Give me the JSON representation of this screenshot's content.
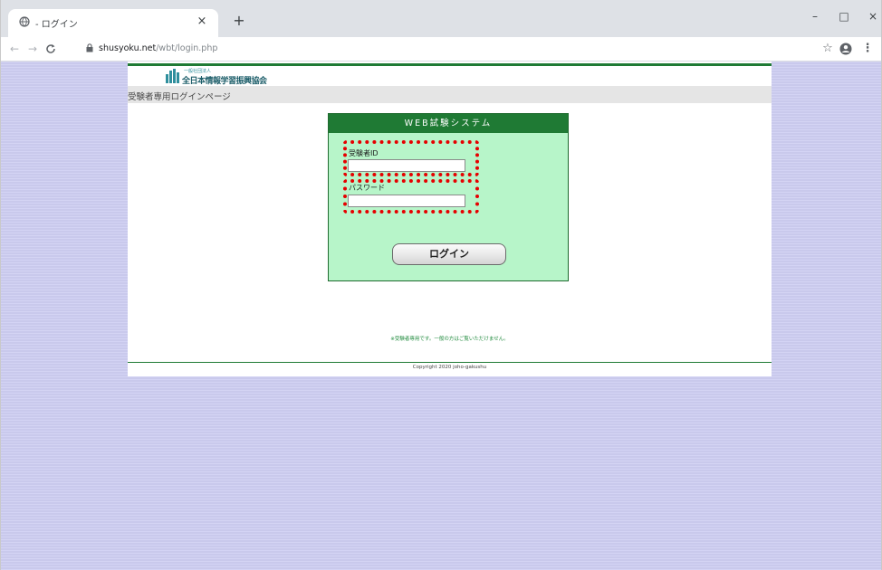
{
  "browser": {
    "tab": {
      "title": "- ログイン",
      "favicon": "globe-icon",
      "close_glyph": "×"
    },
    "new_tab_glyph": "+",
    "window_controls": {
      "minimize": "–",
      "maximize": "□",
      "close": "×"
    },
    "toolbar": {
      "back": "←",
      "forward": "→",
      "reload": "C",
      "lock": "🔒",
      "url_host": "shusyoku.net",
      "url_path": "/wbt/login.php",
      "star": "☆",
      "profile": "●",
      "menu": "⋮"
    }
  },
  "page": {
    "logo": {
      "small_text": "一般社団法人",
      "name": "全日本情報学習振興協会"
    },
    "subtitle": "受験者専用ログインページ",
    "login": {
      "header": "WEB試験システム",
      "id_label": "受験者ID",
      "id_value": "",
      "password_label": "パスワード",
      "password_value": "",
      "button_label": "ログイン"
    },
    "notice": "※受験者専用です。一般の方はご覧いただけません。",
    "copyright": "Copyright 2020 joho-gakushu"
  },
  "colors": {
    "accent": "#1f7a34",
    "login_bg": "#b7f5c9",
    "highlight": "#e60000",
    "background": "#cfcff0"
  }
}
